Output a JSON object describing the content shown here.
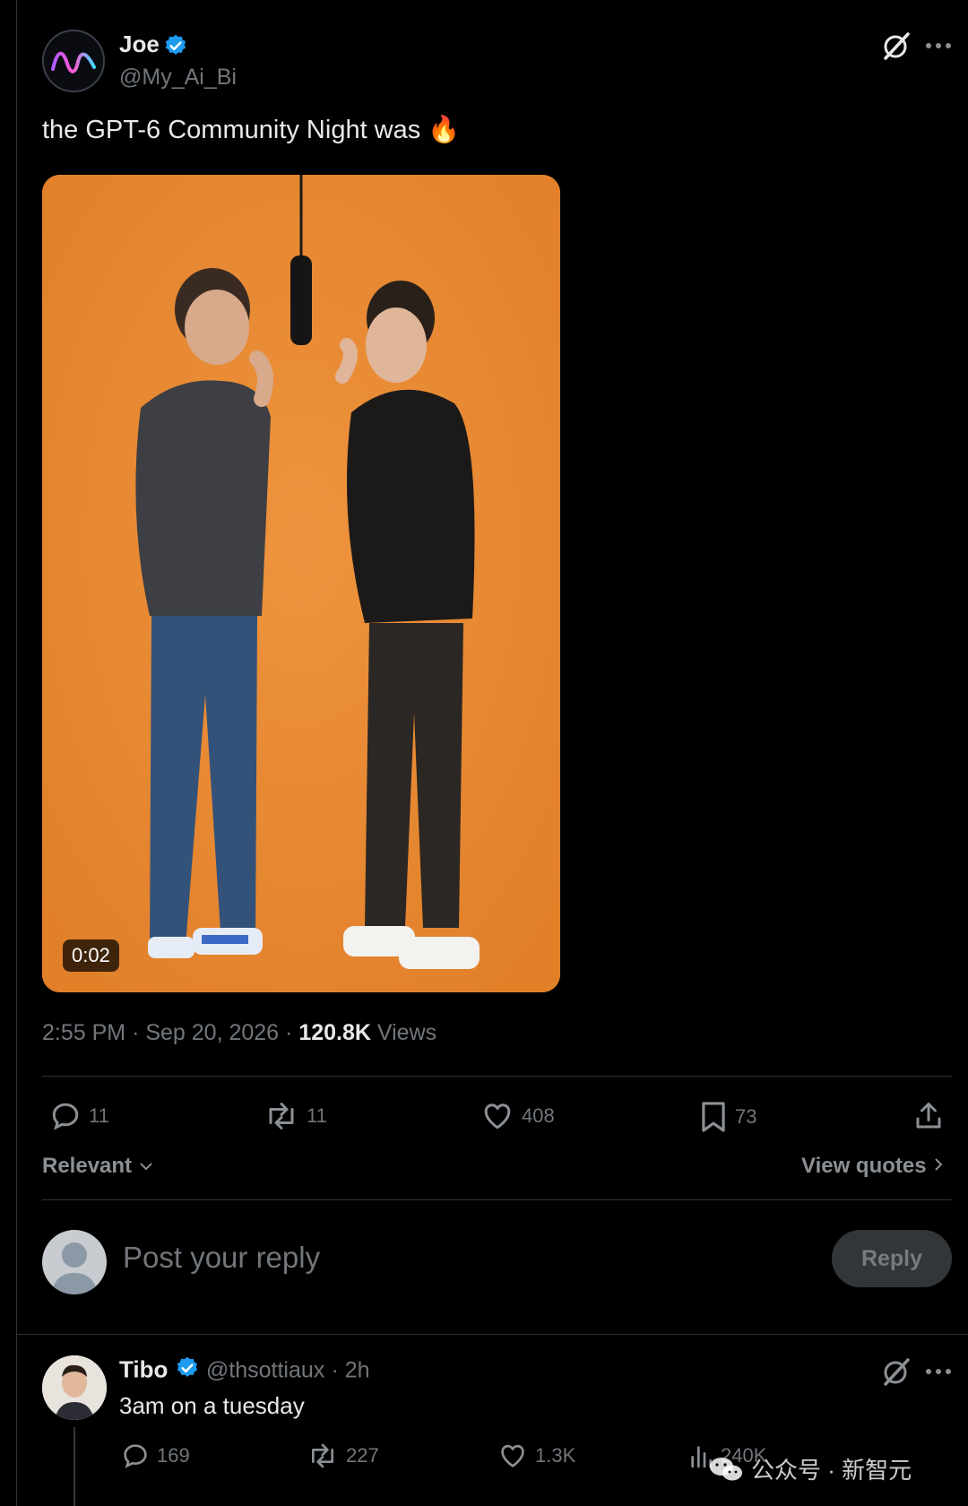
{
  "post": {
    "author_name": "Joe",
    "author_handle": "@My_Ai_Bi",
    "text": "the GPT-6 Community Night was 🔥",
    "video_duration": "0:02",
    "time": "2:55 PM",
    "date": "Sep 20, 2026",
    "views_count": "120.8K",
    "views_label": "Views",
    "replies": "11",
    "reposts": "11",
    "likes": "408",
    "bookmarks": "73"
  },
  "sort": {
    "label": "Relevant",
    "view_quotes": "View quotes"
  },
  "composer": {
    "placeholder": "Post your reply",
    "button": "Reply"
  },
  "reply": {
    "author_name": "Tibo",
    "author_handle": "@thsottiaux",
    "time": "2h",
    "text": "3am on a tuesday",
    "replies": "169",
    "reposts": "227",
    "likes": "1.3K",
    "views": "240K"
  },
  "watermark": {
    "text": "公众号 · 新智元"
  },
  "colors": {
    "verified": "#1d9bf0",
    "muted": "#71767b",
    "accent_orange": "#ea8b34"
  },
  "icons": [
    "grok-icon",
    "more-icon",
    "reply-icon",
    "repost-icon",
    "like-icon",
    "bookmark-icon",
    "share-icon",
    "views-icon",
    "chevron-down-icon",
    "chevron-right-icon"
  ]
}
